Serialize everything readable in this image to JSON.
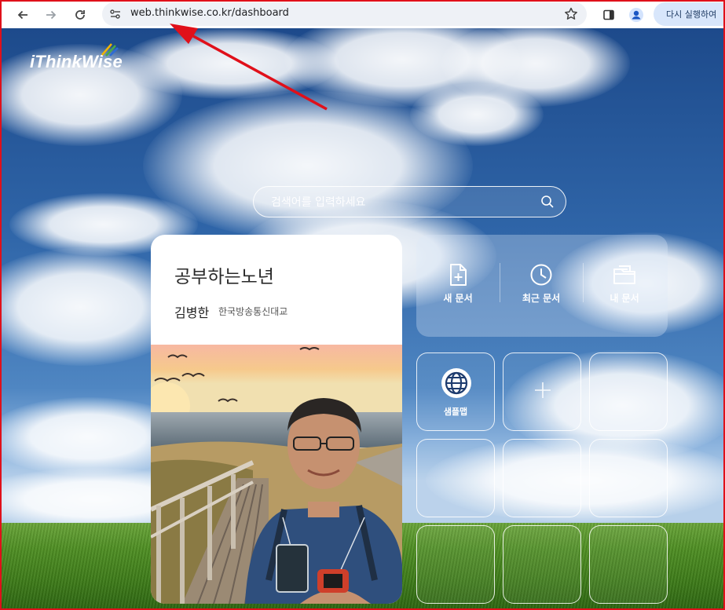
{
  "browser": {
    "url": "web.thinkwise.co.kr/dashboard",
    "relaunch_label": "다시 실행하여",
    "icons": [
      "back-icon",
      "forward-icon",
      "reload-icon",
      "site-settings-icon",
      "bookmark-star-icon",
      "side-panel-icon",
      "profile-icon"
    ]
  },
  "app": {
    "logo_text": "iThinkWise"
  },
  "search": {
    "placeholder": "검색어를 입력하세요"
  },
  "profile": {
    "title": "공부하는노년",
    "name": "김병한",
    "organization": "한국방송통신대교"
  },
  "quick_actions": [
    {
      "label": "새 문서",
      "icon": "new-document-icon"
    },
    {
      "label": "최근 문서",
      "icon": "clock-icon"
    },
    {
      "label": "내 문서",
      "icon": "folder-icon"
    }
  ],
  "tiles": [
    {
      "label": "샘플맵",
      "icon": "globe-icon"
    },
    {
      "label": "",
      "icon": "plus-icon"
    }
  ],
  "colors": {
    "annotation": "#e0101a",
    "chip": "#d8e6fb"
  }
}
